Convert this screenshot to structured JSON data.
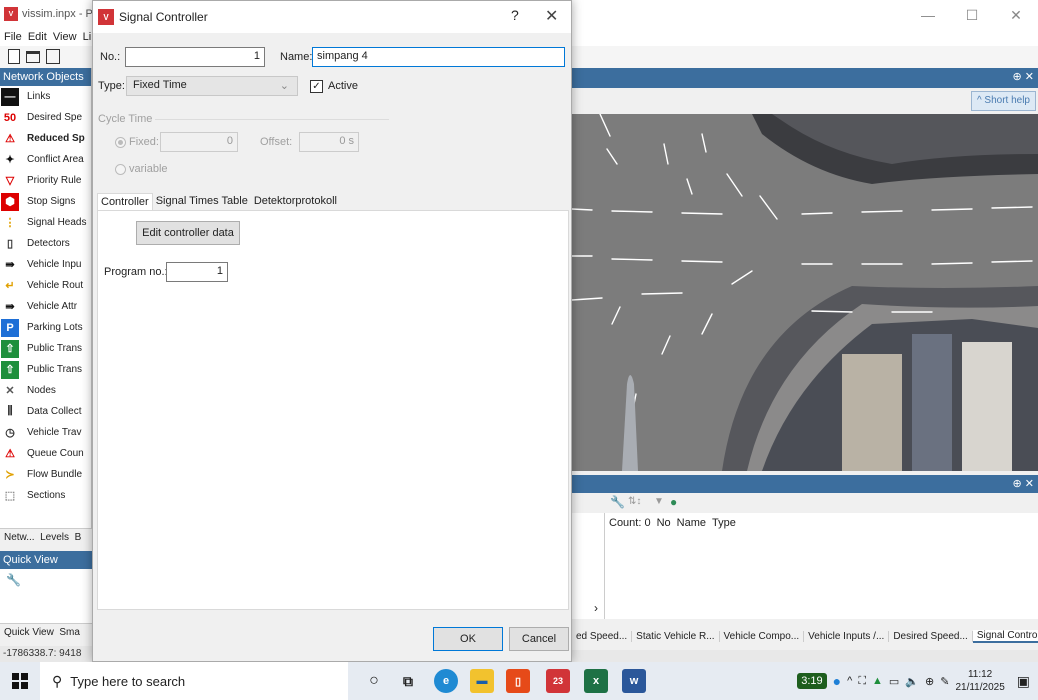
{
  "app": {
    "title": "vissim.inpx - PT",
    "menu": "File  Edit  View  Li",
    "window_controls": [
      "—",
      "☐",
      "✕"
    ]
  },
  "network_objects": {
    "header": "Network Objects",
    "items": [
      {
        "label": "Links",
        "icon": "links-icon"
      },
      {
        "label": "Desired Spe",
        "icon": "speed-50-icon"
      },
      {
        "label": "Reduced Sp",
        "icon": "warning-triangle-icon"
      },
      {
        "label": "Conflict Area",
        "icon": "conflict-area-icon"
      },
      {
        "label": "Priority Rule",
        "icon": "yield-triangle-icon"
      },
      {
        "label": "Stop Signs",
        "icon": "stop-sign-icon"
      },
      {
        "label": "Signal Heads",
        "icon": "traffic-light-icon"
      },
      {
        "label": "Detectors",
        "icon": "detector-icon"
      },
      {
        "label": "Vehicle Inpu",
        "icon": "vehicle-input-icon"
      },
      {
        "label": "Vehicle Rout",
        "icon": "vehicle-route-icon"
      },
      {
        "label": "Vehicle Attr",
        "icon": "vehicle-attr-icon"
      },
      {
        "label": "Parking Lots",
        "icon": "parking-icon"
      },
      {
        "label": "Public Trans",
        "icon": "public-transport-stop-icon"
      },
      {
        "label": "Public Trans",
        "icon": "public-transport-line-icon"
      },
      {
        "label": "Nodes",
        "icon": "nodes-icon"
      },
      {
        "label": "Data Collect",
        "icon": "data-collection-icon"
      },
      {
        "label": "Vehicle Trav",
        "icon": "travel-time-icon"
      },
      {
        "label": "Queue Coun",
        "icon": "queue-counter-icon"
      },
      {
        "label": "Flow Bundle",
        "icon": "flow-bundle-icon"
      },
      {
        "label": "Sections",
        "icon": "sections-icon"
      }
    ],
    "selected_index": 2
  },
  "left_tabs": "Netw...  Levels  B",
  "quick_view": {
    "header": "Quick View"
  },
  "bottom_left_tabs": "Quick View  Sma",
  "status_left": "-1786338.7: 9418",
  "network_editor": {
    "short_help": "^ Short help"
  },
  "lower_list": {
    "columns": [
      "Count: 0",
      "No",
      "Name",
      "Type"
    ],
    "scroll_arrow": "›"
  },
  "bottom_tabs": [
    {
      "label": "ed Speed..."
    },
    {
      "label": "Static Vehicle R..."
    },
    {
      "label": "Vehicle Compo..."
    },
    {
      "label": "Vehicle Inputs /..."
    },
    {
      "label": "Desired Speed..."
    },
    {
      "label": "Signal Controll...",
      "active": true
    }
  ],
  "dialog": {
    "title": "Signal Controller",
    "help": "?",
    "close": "✕",
    "no_label": "No.:",
    "no_value": "1",
    "name_label": "Name:",
    "name_value": "simpang 4",
    "type_label": "Type:",
    "type_value": "Fixed Time",
    "active_label": "Active",
    "active_checked": true,
    "cycle_time_label": "Cycle Time",
    "fixed_label": "Fixed:",
    "fixed_value": "0",
    "offset_label": "Offset:",
    "offset_value": "0 s",
    "variable_label": "variable",
    "tabs": [
      {
        "label": "Controller",
        "active": true
      },
      {
        "label": "Signal Times Table"
      },
      {
        "label": "Detektorprotokoll"
      }
    ],
    "edit_button": "Edit controller data",
    "program_label": "Program no.:",
    "program_value": "1",
    "ok": "OK",
    "cancel": "Cancel"
  },
  "taskbar": {
    "search_placeholder": "Type here to search",
    "tray_badge": "3:19",
    "time": "11:12",
    "date": "21/11/2025",
    "excel_badge": "23"
  }
}
